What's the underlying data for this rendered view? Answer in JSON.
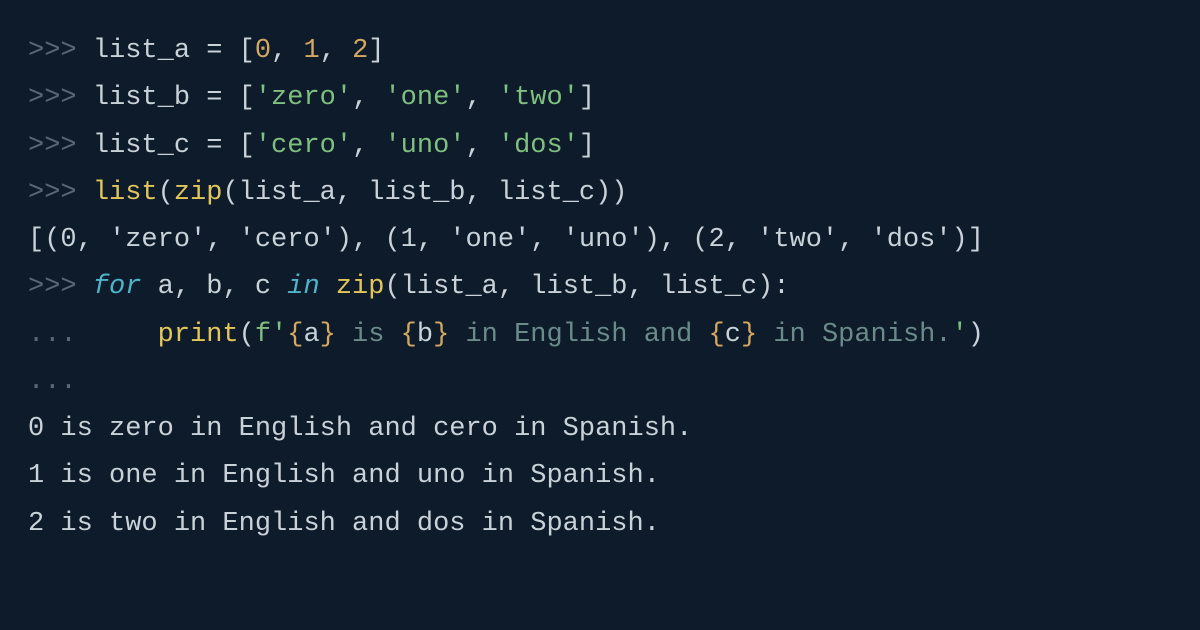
{
  "lines": {
    "l1": {
      "prompt": ">>> ",
      "var": "list_a",
      "sp1": " ",
      "op": "=",
      "sp2": " ",
      "ob": "[",
      "n0": "0",
      "c1": ", ",
      "n1": "1",
      "c2": ", ",
      "n2": "2",
      "cb": "]"
    },
    "l2": {
      "prompt": ">>> ",
      "var": "list_b",
      "sp1": " ",
      "op": "=",
      "sp2": " ",
      "ob": "[",
      "s0": "'zero'",
      "c1": ", ",
      "s1": "'one'",
      "c2": ", ",
      "s2": "'two'",
      "cb": "]"
    },
    "l3": {
      "prompt": ">>> ",
      "var": "list_c",
      "sp1": " ",
      "op": "=",
      "sp2": " ",
      "ob": "[",
      "s0": "'cero'",
      "c1": ", ",
      "s1": "'uno'",
      "c2": ", ",
      "s2": "'dos'",
      "cb": "]"
    },
    "l4": {
      "prompt": ">>> ",
      "fn1": "list",
      "op1": "(",
      "fn2": "zip",
      "op2": "(",
      "a1": "list_a",
      "c1": ", ",
      "a2": "list_b",
      "c2": ", ",
      "a3": "list_c",
      "cp": "))"
    },
    "l5": {
      "text": "[(0, 'zero', 'cero'), (1, 'one', 'uno'), (2, 'two', 'dos')]"
    },
    "l6": {
      "prompt": ">>> ",
      "kw1": "for",
      "sp1": " ",
      "v1": "a",
      "c1": ", ",
      "v2": "b",
      "c2": ", ",
      "v3": "c",
      "sp2": " ",
      "kw2": "in",
      "sp3": " ",
      "fn": "zip",
      "op": "(",
      "a1": "list_a",
      "c3": ", ",
      "a2": "list_b",
      "c4": ", ",
      "a3": "list_c",
      "cp": "):"
    },
    "l7": {
      "prompt": "... ",
      "indent": "    ",
      "fn": "print",
      "op": "(",
      "fp": "f",
      "q1": "'",
      "b1": "{",
      "fv1": "a",
      "b2": "}",
      "t1": " is ",
      "b3": "{",
      "fv2": "b",
      "b4": "}",
      "t2": " in English and ",
      "b5": "{",
      "fv3": "c",
      "b6": "}",
      "t3": " in Spanish.",
      "q2": "'",
      "cp": ")"
    },
    "l8": {
      "prompt": "..."
    },
    "l9": {
      "text": "0 is zero in English and cero in Spanish."
    },
    "l10": {
      "text": "1 is one in English and uno in Spanish."
    },
    "l11": {
      "text": "2 is two in English and dos in Spanish."
    }
  }
}
